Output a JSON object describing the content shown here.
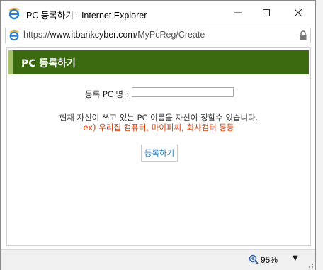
{
  "window": {
    "title": "PC 등록하기 - Internet Explorer",
    "minimize_symbol": "—",
    "maximize_symbol": "☐",
    "close_symbol": "✕"
  },
  "address_bar": {
    "scheme": "https://",
    "host": "www.itbankcyber.com",
    "path": "/MyPcReg/Create",
    "icon": "ie-icon",
    "lock": "lock-icon"
  },
  "form": {
    "header": "PC 등록하기",
    "pc_name_label": "등록 PC 명 :",
    "pc_name_value": "",
    "info": "현재 자신이 쓰고 있는 PC 이름을 자신이 정할수 있습니다.",
    "example": "ex) 우리집 컴퓨터, 마이피씨, 회사컴터 등등",
    "submit_label": "등록하기"
  },
  "status_bar": {
    "zoom": "95%",
    "zoom_icon": "zoom-icon",
    "dropdown_symbol": "▼"
  },
  "colors": {
    "header_bg": "#3b6a10",
    "header_accent": "#a7c26a",
    "example_text": "#e03a00",
    "button_text": "#2a7bbf"
  }
}
